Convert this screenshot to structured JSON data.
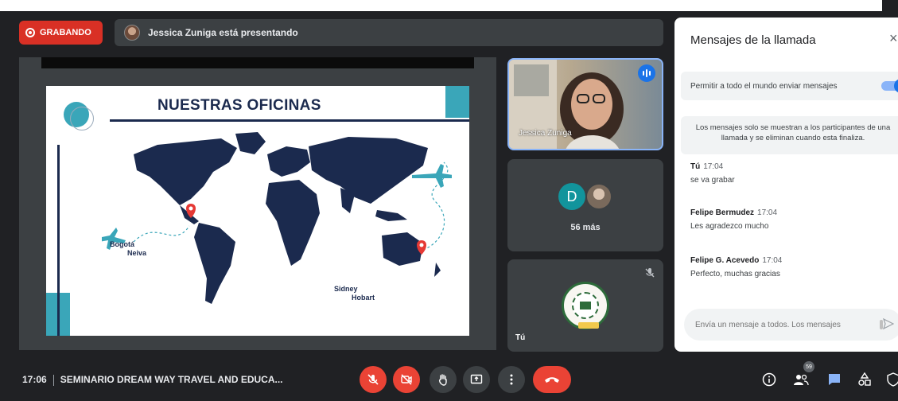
{
  "recording": {
    "label": "GRABANDO"
  },
  "presenter": {
    "text": "Jessica Zuniga está presentando"
  },
  "slide": {
    "title": "NUESTRAS OFICINAS",
    "cities_left": [
      "Bogotá",
      "Neiva"
    ],
    "cities_right": [
      "Sidney",
      "Hobart"
    ]
  },
  "tiles": {
    "speaker_name": "Jessica Zuniga",
    "more_initial": "D",
    "more_label": "56 más",
    "self_label": "Tú"
  },
  "chat": {
    "title": "Mensajes de la llamada",
    "close": "×",
    "allow_label": "Permitir a todo el mundo enviar mensajes",
    "toggle_on": true,
    "note": "Los mensajes solo se muestran a los participantes de una llamada y se eliminan cuando esta finaliza.",
    "messages": [
      {
        "sender": "Tú",
        "time": "17:04",
        "text": "se va grabar"
      },
      {
        "sender": "Felipe Bermudez",
        "time": "17:04",
        "text": "Les agradezco mucho"
      },
      {
        "sender": "Felipe G. Acevedo",
        "time": "17:04",
        "text": "Perfecto, muchas gracias"
      }
    ],
    "input_placeholder": "Envía un mensaje a todos. Los mensajes"
  },
  "bottom": {
    "time": "17:06",
    "meeting_title": "SEMINARIO DREAM WAY TRAVEL AND EDUCA...",
    "participants_count": "59"
  },
  "colors": {
    "accent": "#1a73e8",
    "danger": "#ea4335",
    "panel": "#3c4043",
    "slide_navy": "#1b2a4e",
    "slide_teal": "#3aa6b9"
  }
}
